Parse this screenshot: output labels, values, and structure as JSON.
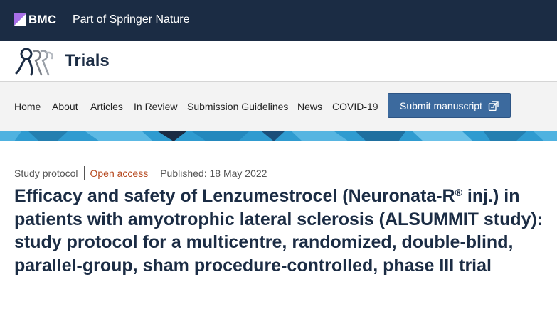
{
  "publisher": {
    "logo_text": "BMC",
    "tagline": "Part of Springer Nature",
    "mark_color": "#a76fe8"
  },
  "journal": {
    "title": "Trials",
    "logo_icon": "trials-figures-logo"
  },
  "nav": {
    "items": [
      {
        "label": "Home"
      },
      {
        "label": "About"
      },
      {
        "label": "Articles",
        "active": true
      },
      {
        "label": "In Review"
      },
      {
        "label": "Submission Guidelines"
      },
      {
        "label": "News"
      },
      {
        "label": "COVID-19"
      }
    ],
    "submit_label": "Submit manuscript",
    "submit_icon": "external-link-icon"
  },
  "article": {
    "type": "Study protocol",
    "access": "Open access",
    "published": "Published: 18 May 2022",
    "title_part1": "Efficacy and safety of Lenzumestrocel (Neuronata-R",
    "title_reg": "®",
    "title_part2": " inj.) in patients with amyotrophic lateral sclerosis (ALSUMMIT study): study protocol for a multicentre, randomized, double-blind, parallel-group, sham procedure-controlled, phase III trial"
  },
  "colors": {
    "header_bg": "#1b2c44",
    "nav_bg": "#f3f3f3",
    "button_bg": "#3c6a9e",
    "open_access": "#b5461b",
    "banner_bg": "#2f9bd0"
  }
}
